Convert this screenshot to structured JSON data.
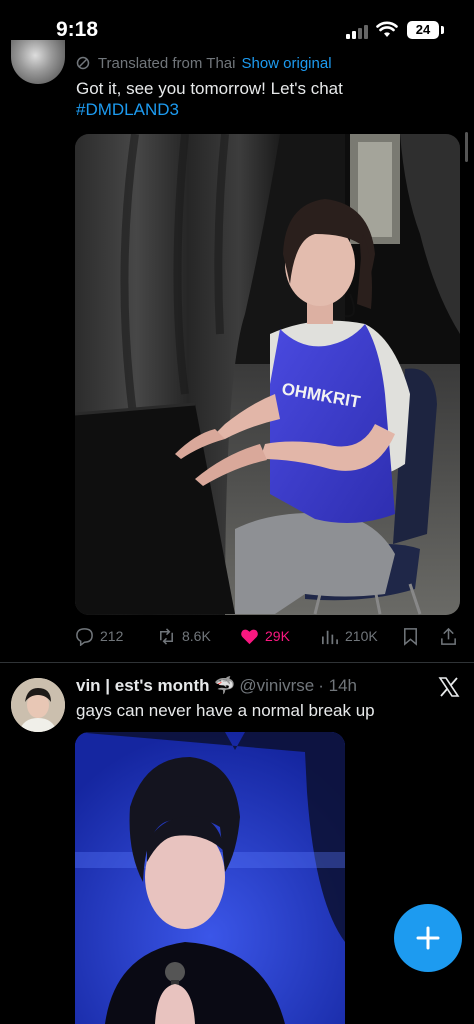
{
  "status_bar": {
    "time": "9:18",
    "battery": "24"
  },
  "tweet1": {
    "translated_label": "Translated from Thai",
    "show_original": "Show original",
    "text_line1": "Got it, see you tomorrow! Let's chat",
    "hashtag": "#DMDLAND3",
    "jersey_text": "OHMKRIT",
    "actions": {
      "replies": "212",
      "retweets": "8.6K",
      "likes": "29K",
      "views": "210K"
    },
    "like_color": "#f91880"
  },
  "tweet2": {
    "display_name": "vin | est's month 🦈",
    "handle": "@vinivrse",
    "time": "· 14h",
    "text": "gays can never have a normal break up"
  },
  "fab": {
    "icon": "plus-icon",
    "color": "#1d9bf0"
  },
  "icons": [
    "signal-icon",
    "wifi-icon",
    "battery-icon",
    "translate-icon",
    "reply-icon",
    "retweet-icon",
    "heart-icon",
    "views-icon",
    "bookmark-icon",
    "share-icon",
    "x-logo-icon",
    "plus-icon"
  ]
}
